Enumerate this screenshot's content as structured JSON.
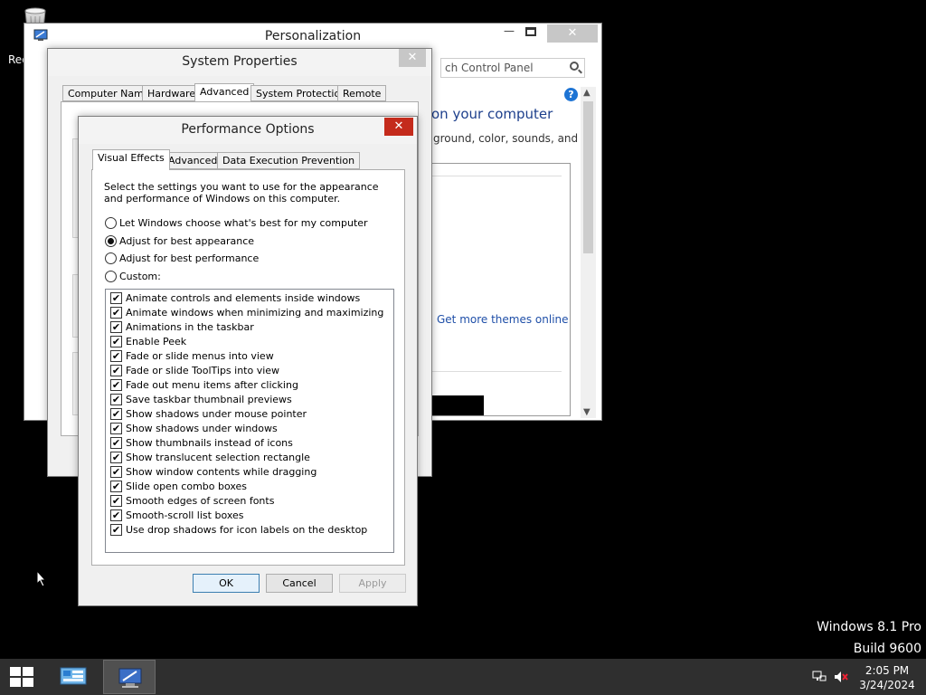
{
  "desktop": {
    "recycle_bin_label": "Rec",
    "watermark_line1": "Windows 8.1 Pro",
    "watermark_line2": "Build 9600"
  },
  "personalization": {
    "title": "Personalization",
    "minimize": "—",
    "close": "✕",
    "search_placeholder": "ch Control Panel",
    "help": "?",
    "heading": "on your computer",
    "description": "ground, color, sounds, and",
    "link": "Get more themes online"
  },
  "system_properties": {
    "title": "System Properties",
    "close": "✕",
    "tabs": [
      "Computer Name",
      "Hardware",
      "Advanced",
      "System Protection",
      "Remote"
    ],
    "active_tab": "Advanced"
  },
  "performance_options": {
    "title": "Performance Options",
    "close": "✕",
    "tabs": [
      "Visual Effects",
      "Advanced",
      "Data Execution Prevention"
    ],
    "active_tab": "Visual Effects",
    "description": "Select the settings you want to use for the appearance and performance of Windows on this computer.",
    "radios": [
      {
        "label": "Let Windows choose what's best for my computer",
        "selected": false
      },
      {
        "label": "Adjust for best appearance",
        "selected": true
      },
      {
        "label": "Adjust for best performance",
        "selected": false
      },
      {
        "label": "Custom:",
        "selected": false
      }
    ],
    "effects": [
      {
        "label": "Animate controls and elements inside windows",
        "checked": true
      },
      {
        "label": "Animate windows when minimizing and maximizing",
        "checked": true
      },
      {
        "label": "Animations in the taskbar",
        "checked": true
      },
      {
        "label": "Enable Peek",
        "checked": true
      },
      {
        "label": "Fade or slide menus into view",
        "checked": true
      },
      {
        "label": "Fade or slide ToolTips into view",
        "checked": true
      },
      {
        "label": "Fade out menu items after clicking",
        "checked": true
      },
      {
        "label": "Save taskbar thumbnail previews",
        "checked": true
      },
      {
        "label": "Show shadows under mouse pointer",
        "checked": true
      },
      {
        "label": "Show shadows under windows",
        "checked": true
      },
      {
        "label": "Show thumbnails instead of icons",
        "checked": true
      },
      {
        "label": "Show translucent selection rectangle",
        "checked": true
      },
      {
        "label": "Show window contents while dragging",
        "checked": true
      },
      {
        "label": "Slide open combo boxes",
        "checked": true
      },
      {
        "label": "Smooth edges of screen fonts",
        "checked": true
      },
      {
        "label": "Smooth-scroll list boxes",
        "checked": true
      },
      {
        "label": "Use drop shadows for icon labels on the desktop",
        "checked": true
      }
    ],
    "ok_label": "OK",
    "cancel_label": "Cancel",
    "apply_label": "Apply"
  },
  "taskbar": {
    "time": "2:05 PM",
    "date": "3/24/2024",
    "items": [
      "control-panel-icon",
      "system-properties-icon"
    ]
  },
  "colors": {
    "desktop_background": "#000000",
    "taskbar": "#2f2f2f",
    "close_red": "#c42b1c",
    "link_blue": "#1f4fa8"
  }
}
